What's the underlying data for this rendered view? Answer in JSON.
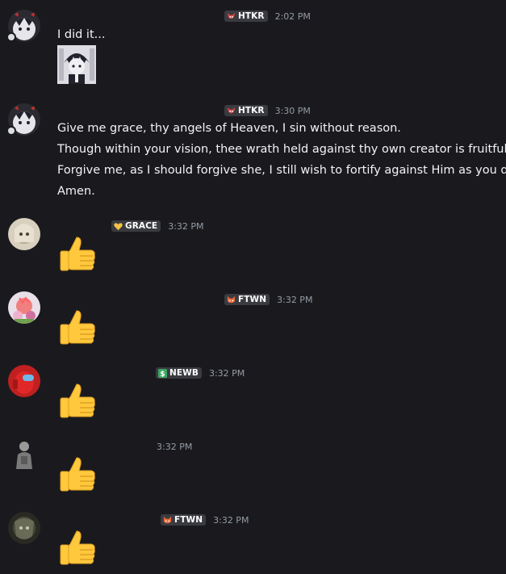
{
  "messages": [
    {
      "id": "m1",
      "author_tag": "HTKR",
      "author_tag_icon": "devil-icon",
      "time": "2:02 PM",
      "lines": [
        "I did it..."
      ],
      "attachment": "anime-character-image",
      "status": "idle"
    },
    {
      "id": "m2",
      "author_tag": "HTKR",
      "author_tag_icon": "devil-icon",
      "time": "3:30 PM",
      "lines": [
        "Give me grace, thy angels of Heaven, I sin without reason.",
        "Though within your vision, thee wrath held against thy own creator is fruitful.",
        "Forgive me, as I should forgive she, I still wish to fortify against Him as you do.",
        "Amen."
      ],
      "status": "idle"
    },
    {
      "id": "m3",
      "author_tag": "GRACE",
      "author_tag_icon": "yellow-heart-icon",
      "time": "3:32 PM",
      "content": "thumbs-up-emoji"
    },
    {
      "id": "m4",
      "author_tag": "FTWN",
      "author_tag_icon": "fox-icon",
      "time": "3:32 PM",
      "content": "thumbs-up-emoji"
    },
    {
      "id": "m5",
      "author_tag": "NEWB",
      "author_tag_icon": "dollar-icon",
      "time": "3:32 PM",
      "content": "thumbs-up-emoji"
    },
    {
      "id": "m6",
      "author_tag": "",
      "time": "3:32 PM",
      "content": "thumbs-up-emoji"
    },
    {
      "id": "m7",
      "author_tag": "FTWN",
      "author_tag_icon": "fox-icon",
      "time": "3:32 PM",
      "content": "thumbs-up-emoji"
    }
  ],
  "colors": {
    "background": "#1a1a1e",
    "text": "#f2f3f5",
    "timestamp": "#949ba4",
    "tag_bg": "#3a3b40",
    "thumb_yellow": "#ffc83d"
  }
}
